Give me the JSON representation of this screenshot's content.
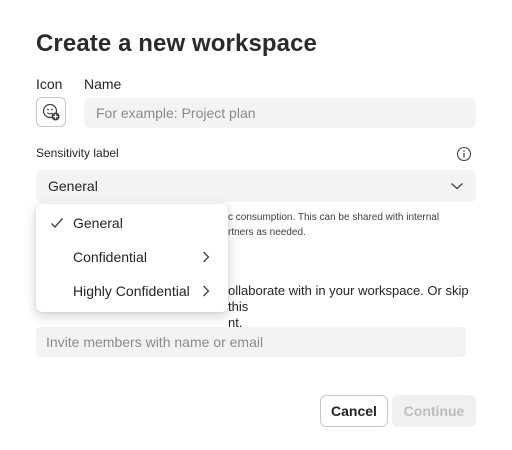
{
  "dialog": {
    "title": "Create a new workspace",
    "icon_label": "Icon",
    "name_label": "Name",
    "name_placeholder": "For example: Project plan",
    "sensitivity_label": "Sensitivity label",
    "sensitivity_value": "General",
    "sensitivity_desc_line1": "c consumption. This can be shared with internal",
    "sensitivity_desc_line2": "rtners as needed.",
    "invite_text_line1": "ollaborate with in your workspace. Or skip this",
    "invite_text_line2": "nt.",
    "invite_placeholder": "Invite members with name or email",
    "cancel_label": "Cancel",
    "continue_label": "Continue"
  },
  "dropdown": {
    "items": [
      {
        "label": "General",
        "selected": true,
        "has_submenu": false
      },
      {
        "label": "Confidential",
        "selected": false,
        "has_submenu": true
      },
      {
        "label": "Highly Confidential",
        "selected": false,
        "has_submenu": true
      }
    ]
  },
  "icons": {
    "icon_picker": "emoji-add-icon",
    "info": "info-icon",
    "select_chevron": "chevron-down-icon",
    "check": "checkmark-icon",
    "submenu": "chevron-right-icon"
  },
  "colors": {
    "field_bg": "#f3f3f3",
    "border": "#c7c7c7",
    "disabled_text": "#bdbdbd"
  }
}
